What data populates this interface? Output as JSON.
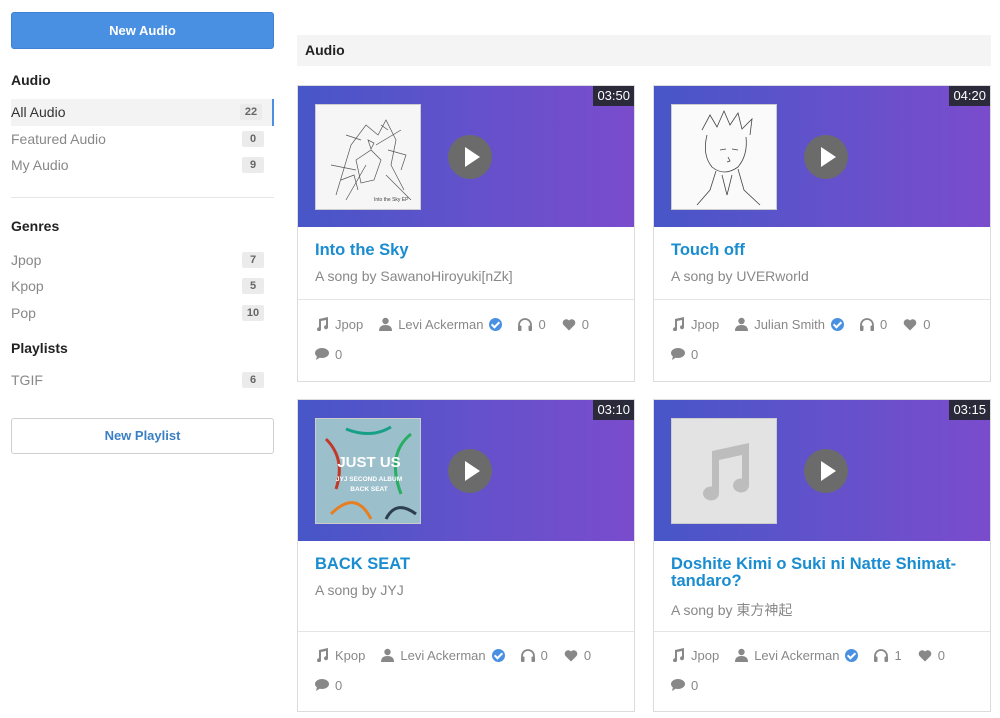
{
  "sidebar": {
    "new_audio": "New Audio",
    "audio_heading": "Audio",
    "audio_items": [
      {
        "label": "All Audio",
        "count": "22"
      },
      {
        "label": "Featured Audio",
        "count": "0"
      },
      {
        "label": "My Audio",
        "count": "9"
      }
    ],
    "genres_heading": "Genres",
    "genre_items": [
      {
        "label": "Jpop",
        "count": "7"
      },
      {
        "label": "Kpop",
        "count": "5"
      },
      {
        "label": "Pop",
        "count": "10"
      }
    ],
    "playlists_heading": "Playlists",
    "playlist_items": [
      {
        "label": "TGIF",
        "count": "6"
      }
    ],
    "new_playlist": "New Playlist"
  },
  "main": {
    "section_title": "Audio",
    "cards": [
      {
        "duration": "03:50",
        "title": "Into the Sky",
        "subtitle": "A song by SawanoHiroyuki[nZk]",
        "genre": "Jpop",
        "author": "Levi Ackerman",
        "listens": "0",
        "likes": "0",
        "comments": "0",
        "thumb_caption": "Into the Sky EP"
      },
      {
        "duration": "04:20",
        "title": "Touch off",
        "subtitle": "A song by UVERworld",
        "genre": "Jpop",
        "author": "Julian Smith",
        "listens": "0",
        "likes": "0",
        "comments": "0"
      },
      {
        "duration": "03:10",
        "title": "BACK SEAT",
        "subtitle": "A song by JYJ",
        "genre": "Kpop",
        "author": "Levi Ackerman",
        "listens": "0",
        "likes": "0",
        "comments": "0",
        "thumb_text_1": "JUST US",
        "thumb_text_2": "JYJ SECOND ALBUM",
        "thumb_text_3": "BACK SEAT"
      },
      {
        "duration": "03:15",
        "title": "Doshite Kimi o Suki ni Natte Shimat-tandaro?",
        "subtitle": "A song by 東方神起",
        "genre": "Jpop",
        "author": "Levi Ackerman",
        "listens": "1",
        "likes": "0",
        "comments": "0"
      }
    ]
  },
  "colors": {
    "accent": "#4a90e2",
    "title_link": "#1a8cd0",
    "banner_start": "#4756c7",
    "banner_end": "#7a4ccc"
  }
}
